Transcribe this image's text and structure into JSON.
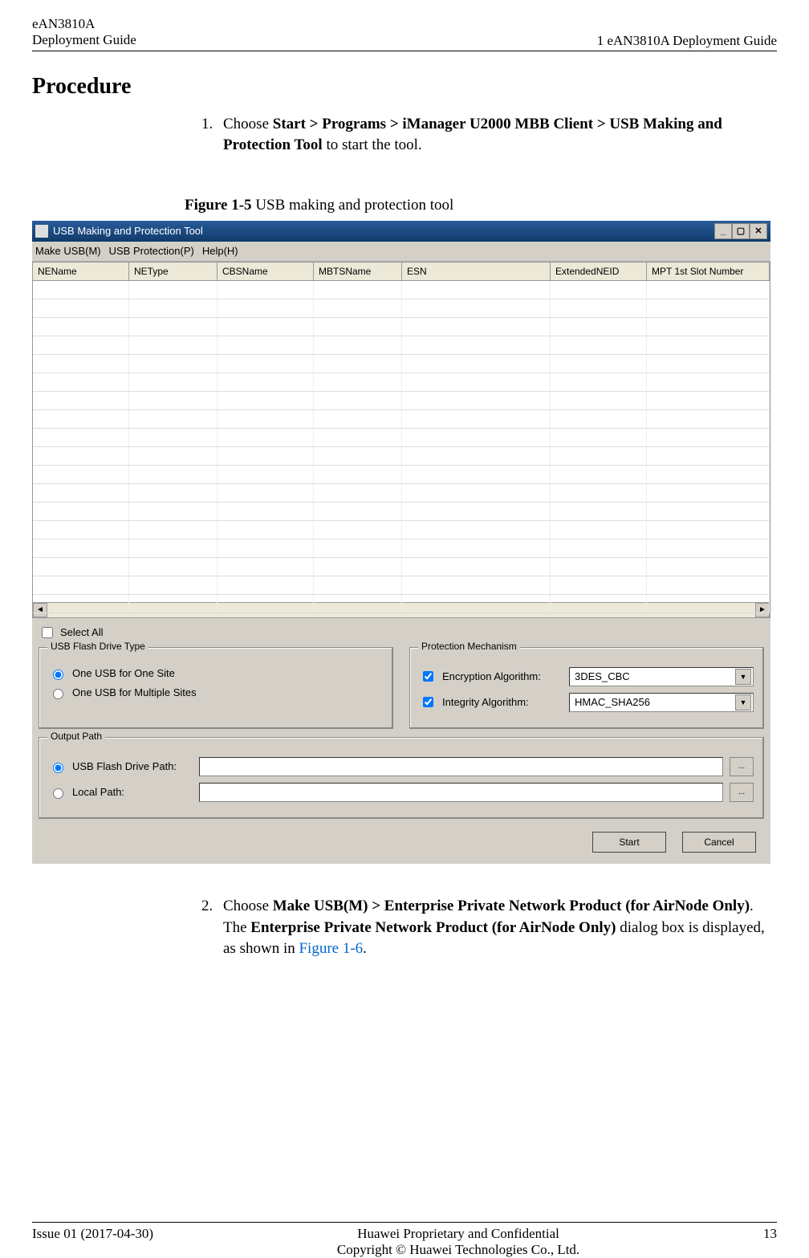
{
  "doc_header": {
    "product": "eAN3810A",
    "subtitle": "Deployment Guide",
    "chapter": "1 eAN3810A Deployment Guide"
  },
  "section_title": "Procedure",
  "step1": {
    "num": "1.",
    "lead": "Choose ",
    "path": "Start > Programs > iManager U2000 MBB Client > USB Making and Protection Tool",
    "tail": " to start the tool."
  },
  "figure_caption": {
    "label": "Figure 1-5",
    "text": " USB making and protection tool"
  },
  "app": {
    "title": "USB Making and Protection Tool",
    "menu": {
      "make_usb": "Make USB(M)",
      "protection": "USB Protection(P)",
      "help": "Help(H)"
    },
    "columns": [
      "NEName",
      "NEType",
      "CBSName",
      "MBTSName",
      "ESN",
      "ExtendedNEID",
      "MPT 1st Slot Number"
    ],
    "select_all": "Select All",
    "group_drive_type": "USB Flash Drive Type",
    "radio_one_site": "One USB for One Site",
    "radio_multi_site": "One USB for Multiple Sites",
    "group_protection": "Protection Mechanism",
    "chk_encryption": "Encryption Algorithm:",
    "val_encryption": "3DES_CBC",
    "chk_integrity": "Integrity Algorithm:",
    "val_integrity": "HMAC_SHA256",
    "group_output": "Output Path",
    "radio_usb_path": "USB Flash Drive Path:",
    "radio_local_path": "Local Path:",
    "btn_start": "Start",
    "btn_cancel": "Cancel"
  },
  "step2": {
    "num": "2.",
    "lead": "Choose ",
    "path": "Make USB(M) > Enterprise Private Network Product (for AirNode Only)",
    "mid1": ". The ",
    "bold2": "Enterprise Private Network Product (for AirNode Only)",
    "mid2": " dialog box is displayed, as shown in ",
    "link": "Figure 1-6",
    "tail": "."
  },
  "footer": {
    "issue": "Issue 01 (2017-04-30)",
    "line1": "Huawei Proprietary and Confidential",
    "line2": "Copyright © Huawei Technologies Co., Ltd.",
    "page": "13"
  }
}
